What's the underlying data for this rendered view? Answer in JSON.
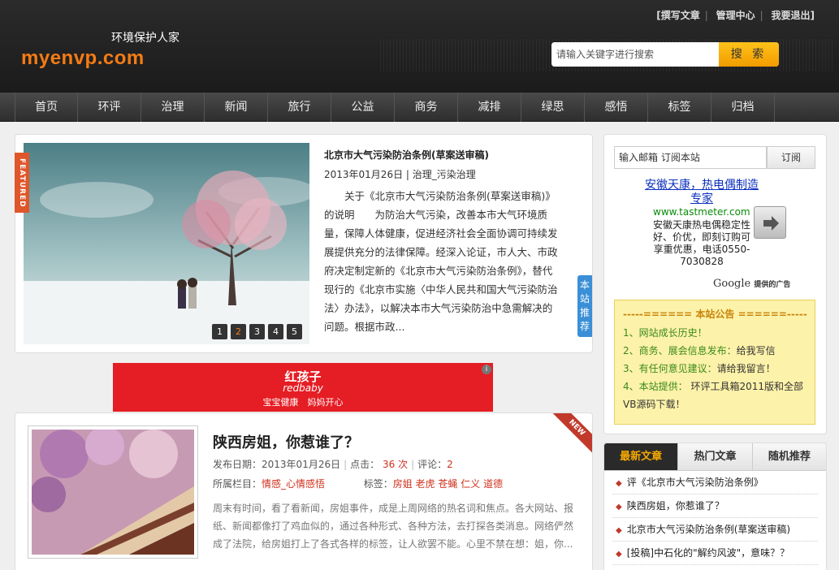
{
  "header": {
    "tagline": "环境保护人家",
    "logo": "myenvp.com",
    "links": [
      "[撰写文章",
      "管理中心",
      "我要退出]"
    ],
    "search_placeholder": "请输入关键字进行搜索",
    "search_button": "搜 索"
  },
  "nav": [
    "首页",
    "环评",
    "治理",
    "新闻",
    "旅行",
    "公益",
    "商务",
    "减排",
    "绿思",
    "感悟",
    "标签",
    "归档"
  ],
  "featured": {
    "tag": "FEATURED",
    "title": "北京市大气污染防治条例(草案送审稿)",
    "meta": "2013年01月26日 | 治理_污染治理",
    "body": "关于《北京市大气污染防治条例(草案送审稿)》的说明　　为防治大气污染，改善本市大气环境质量，保障人体健康，促进经济社会全面协调可持续发展提供充分的法律保障。经深入论证，市人大、市政府决定制定新的《北京市大气污染防治条例》，替代现行的《北京市实施〈中华人民共和国大气污染防治法〉办法》，以解决本市大气污染防治中急需解决的问题。根据市政...",
    "slides": [
      "1",
      "2",
      "3",
      "4",
      "5"
    ],
    "active_slide": 2,
    "side_tab": "本站推荐"
  },
  "ad": {
    "brand": "红孩子",
    "brand_en": "redbaby",
    "slogan": "宝宝健康　妈妈开心"
  },
  "article": {
    "ribbon": "NEW",
    "title": "陕西房姐，你惹谁了？",
    "date_label": "发布日期：",
    "date": "2013年01月26日",
    "clicks_label": "点击：",
    "clicks": "36 次",
    "comments_label": "评论：",
    "comments": "2",
    "category_label": "所属栏目：",
    "category": "情感_心情感悟",
    "tags_label": "标签：",
    "tags": [
      "房姐",
      "老虎",
      "苍蝇",
      "仁义",
      "道德"
    ],
    "body": "周末有时间，看了看新闻，房姐事件，成是上周网络的热名词和焦点。各大网站、报纸、新闻都像打了鸡血似的，通过各种形式、各种方法，去打探各类消息。网络俨然成了法院，给房姐打上了各式各样的标签，让人欲罢不能。心里不禁在想：姐，你..."
  },
  "sidebar": {
    "subscribe_value": "输入邮箱 订阅本站",
    "subscribe_button": "订阅",
    "google_ad": {
      "title": "安徽天康，热电偶制造专家",
      "url": "www.tastmeter.com",
      "text": "安徽天康热电偶稳定性好、价优，即刻订购可享重优惠，电话0550-7030828",
      "google": "Google",
      "google_suffix": "提供的广告"
    },
    "notice": {
      "title": "-----====== 本站公告 ======-----",
      "items": [
        {
          "num": "1、",
          "label": "网站成长历史！"
        },
        {
          "num": "2、",
          "label": "商务、展会信息发布：",
          "extra": "给我写信"
        },
        {
          "num": "3、",
          "label": "有任何意见建议：",
          "extra": "请给我留言！"
        },
        {
          "num": "4、",
          "label": "本站提供：",
          "extra": " 环评工具箱2011版和全部VB源码下载！"
        }
      ]
    },
    "tabs": [
      "最新文章",
      "热门文章",
      "随机推荐"
    ],
    "recent": [
      "评《北京市大气污染防治条例》",
      "陕西房姐，你惹谁了？",
      "北京市大气污染防治条例(草案送审稿)",
      "[投稿]中石化的\"解约风波\"，意味？？"
    ]
  },
  "colors": {
    "accent": "#f57b14",
    "nav_bg": "#3a3a3a",
    "link_blue": "#0b2fbd",
    "notice_bg": "#fdf2a9"
  }
}
